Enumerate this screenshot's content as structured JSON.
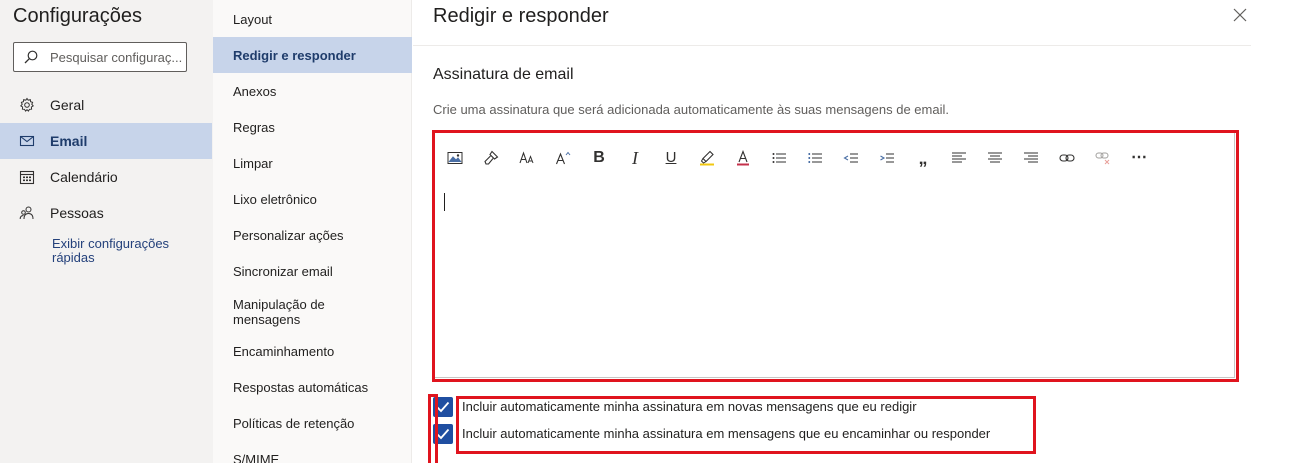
{
  "app_title": "Configurações",
  "search": {
    "placeholder": "Pesquisar configuraç..."
  },
  "nav": [
    {
      "label": "Geral",
      "icon": "gear-icon"
    },
    {
      "label": "Email",
      "icon": "mail-icon",
      "selected": true
    },
    {
      "label": "Calendário",
      "icon": "calendar-icon"
    },
    {
      "label": "Pessoas",
      "icon": "people-icon"
    }
  ],
  "quick_settings": {
    "line1": "Exibir configurações",
    "line2": "rápidas"
  },
  "sub_nav": [
    {
      "label": "Layout"
    },
    {
      "label": "Redigir e responder",
      "selected": true
    },
    {
      "label": "Anexos"
    },
    {
      "label": "Regras"
    },
    {
      "label": "Limpar"
    },
    {
      "label": "Lixo eletrônico"
    },
    {
      "label": "Personalizar ações"
    },
    {
      "label": "Sincronizar email"
    },
    {
      "label": "Manipulação de",
      "label2": "mensagens"
    },
    {
      "label": "Encaminhamento"
    },
    {
      "label": "Respostas automáticas"
    },
    {
      "label": "Políticas de retenção"
    },
    {
      "label": "S/MIME"
    }
  ],
  "panel": {
    "title": "Redigir e responder",
    "section_title": "Assinatura de email",
    "description": "Crie uma assinatura que será adicionada automaticamente às suas mensagens de email.",
    "toolbar": {
      "icons": [
        "insert-image-icon",
        "format-painter-icon",
        "font-size-icon",
        "grow-font-icon",
        "bold-icon",
        "italic-icon",
        "underline-icon",
        "highlight-icon",
        "font-color-icon",
        "bullets-icon",
        "numbering-icon",
        "decrease-indent-icon",
        "increase-indent-icon",
        "quote-icon",
        "align-left-icon",
        "align-center-icon",
        "align-right-icon",
        "insert-link-icon",
        "remove-link-icon",
        "more-options-icon"
      ],
      "bold_glyph": "B",
      "italic_glyph": "I",
      "underline_glyph": "U",
      "quote_glyph": "„",
      "more_glyph": "⋯"
    },
    "checkbox_new": {
      "label": "Incluir automaticamente minha assinatura em novas mensagens que eu redigir",
      "checked": true
    },
    "checkbox_reply": {
      "label": "Incluir automaticamente minha assinatura em mensagens que eu encaminhar ou responder",
      "checked": true
    }
  },
  "colors": {
    "accent": "#1f4ea1",
    "selection": "#c7d4ea",
    "highlight_box": "#e0141e"
  }
}
